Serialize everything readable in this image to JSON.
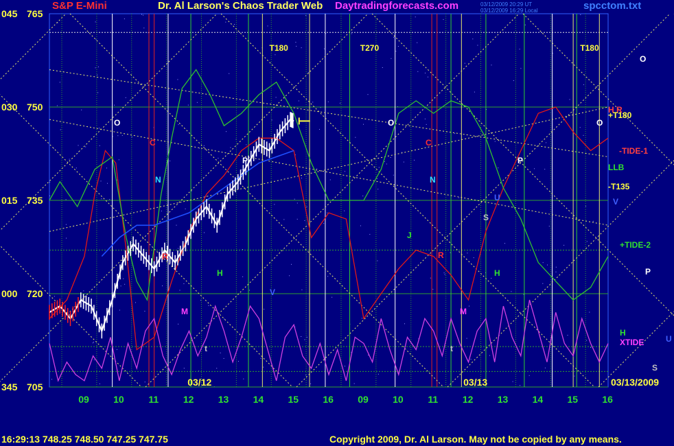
{
  "header": {
    "symbol_title": "S&P E-Mini",
    "app_title": "Dr. Al Larson's Chaos Trader Web",
    "site": "Daytradingforecasts.com",
    "timestamp_line1": "03/12/2009 20:29 UT",
    "timestamp_line2": "03/12/2009 16:29 Local",
    "file_name": "spcctom.txt"
  },
  "footer": {
    "quote": "16:29:13  748.25  748.50  747.25  747.75",
    "copyright": "Copyright 2009, Dr. Al Larson. May not be copied by any means."
  },
  "colors": {
    "background": "#00007f",
    "price_bars": "#ffffff",
    "red_line": "#e01818",
    "green_line": "#30c030",
    "blue_line": "#1f4fff",
    "magenta_xtide": "#d040e0",
    "gann_yellow": "#e8e870",
    "grid_green": "#2fa02f",
    "vertical_white": "#ffffff",
    "vertical_yellow": "#e8e870",
    "vertical_red": "#e02020",
    "vertical_green": "#30d030"
  },
  "chart_data": {
    "type": "line",
    "title": "S&P E-Mini",
    "ylabel_left": [
      "345",
      "000",
      "015",
      "030",
      "045"
    ],
    "y_ticks": [
      705,
      720,
      735,
      750,
      765
    ],
    "ylim": [
      705,
      765
    ],
    "x_session_labels": [
      "09",
      "10",
      "11",
      "12",
      "13",
      "14",
      "15",
      "16",
      "09",
      "10",
      "11",
      "12",
      "13",
      "14",
      "15",
      "16"
    ],
    "date_labels": [
      "03/12",
      "03/13",
      "03/13/2009"
    ],
    "grid": true,
    "timing_labels": [
      "T180",
      "T270",
      "T180"
    ],
    "right_labels": [
      "H R",
      "+T180",
      "O",
      "-TIDE-1",
      "LLB",
      "-T135",
      "V",
      "+TIDE-2",
      "P",
      "H",
      "XTIDE",
      "U",
      "S"
    ],
    "in_chart_letters_day1": [
      "O",
      "C",
      "N",
      "P",
      "H",
      "V",
      "M",
      "t",
      "R"
    ],
    "in_chart_letters_day2": [
      "O",
      "C",
      "N",
      "J",
      "R",
      "S",
      "U",
      "P",
      "H",
      "M",
      "t"
    ],
    "series": [
      {
        "name": "price",
        "x": [
          0,
          0.3,
          0.6,
          0.9,
          1.2,
          1.5,
          1.8,
          2.1,
          2.4,
          2.7,
          3.0,
          3.3,
          3.6,
          3.9,
          4.2,
          4.5,
          4.8,
          5.1,
          5.4,
          5.7,
          6.0,
          6.3,
          6.6,
          6.9,
          7.0
        ],
        "values": [
          717,
          718,
          716,
          719,
          718,
          714,
          719,
          725,
          728,
          726,
          724,
          727,
          725,
          728,
          732,
          734,
          731,
          736,
          738,
          741,
          744,
          743,
          746,
          748,
          747.75
        ]
      },
      {
        "name": "red",
        "x": [
          0,
          0.5,
          1.0,
          1.3,
          1.6,
          1.9,
          2.2,
          2.5,
          3.0,
          3.5,
          4.0,
          4.5,
          5.0,
          5.5,
          6.0,
          6.5,
          7.0,
          7.5,
          8.0,
          8.5,
          9.0,
          9.5,
          10.0,
          10.5,
          11.0,
          11.5,
          12.0,
          12.5,
          13.0,
          13.5,
          14.0,
          14.5,
          15.0,
          15.5,
          16.0
        ],
        "values": [
          716,
          719,
          726,
          736,
          743,
          741,
          727,
          711,
          713,
          722,
          730,
          736,
          739,
          743,
          745,
          745,
          743,
          729,
          733,
          732,
          716,
          720,
          724,
          727,
          726,
          723,
          719,
          730,
          737,
          743,
          749,
          750,
          746,
          743,
          745
        ]
      },
      {
        "name": "green",
        "x": [
          0,
          0.3,
          0.8,
          1.3,
          1.8,
          2.2,
          2.5,
          2.8,
          3.2,
          3.5,
          3.8,
          4.2,
          4.6,
          5.0,
          5.5,
          6.0,
          6.5,
          7.0,
          7.5,
          8.0,
          8.5,
          9.0,
          9.5,
          10.0,
          10.5,
          11.0,
          11.5,
          12.0,
          12.5,
          13.0,
          13.5,
          14.0,
          14.5,
          15.0,
          15.5,
          15.8,
          16.0
        ],
        "values": [
          735,
          738,
          734,
          740,
          742,
          729,
          722,
          719,
          736,
          745,
          753,
          756,
          752,
          747,
          749,
          752,
          754,
          749,
          741,
          735,
          735,
          735,
          740,
          749,
          751,
          749,
          751,
          750,
          745,
          737,
          732,
          725,
          722,
          719,
          721,
          724,
          726
        ]
      },
      {
        "name": "blue",
        "x": [
          1.5,
          2.0,
          2.5,
          3.0,
          3.5,
          4.0,
          4.5,
          5.0,
          5.5,
          6.0,
          6.5,
          7.0
        ],
        "values": [
          726,
          729,
          731,
          731,
          732,
          733,
          735,
          737,
          739,
          741,
          742,
          743
        ]
      },
      {
        "name": "xtide",
        "x": [
          0,
          0.25,
          0.5,
          0.75,
          1.0,
          1.25,
          1.5,
          1.75,
          2.0,
          2.25,
          2.5,
          2.75,
          3.0,
          3.25,
          3.5,
          3.75,
          4.0,
          4.25,
          4.5,
          4.75,
          5.0,
          5.25,
          5.5,
          5.75,
          6.0,
          6.25,
          6.5,
          6.75,
          7.0,
          7.25,
          7.5,
          7.75,
          8.0,
          8.25,
          8.5,
          8.75,
          9.0,
          9.25,
          9.5,
          9.75,
          10.0,
          10.25,
          10.5,
          10.75,
          11.0,
          11.25,
          11.5,
          11.75,
          12.0,
          12.25,
          12.5,
          12.75,
          13.0,
          13.25,
          13.5,
          13.75,
          14.0,
          14.25,
          14.5,
          14.75,
          15.0,
          15.25,
          15.5,
          15.75,
          16.0
        ],
        "values": [
          712,
          706,
          709,
          707,
          706,
          710,
          708,
          713,
          706,
          712,
          708,
          714,
          716,
          710,
          707,
          711,
          714,
          710,
          713,
          718,
          714,
          709,
          713,
          718,
          716,
          711,
          706,
          713,
          715,
          710,
          708,
          712,
          707,
          711,
          706,
          713,
          712,
          709,
          716,
          711,
          707,
          713,
          711,
          716,
          714,
          710,
          716,
          712,
          709,
          714,
          716,
          709,
          718,
          713,
          710,
          719,
          714,
          709,
          717,
          712,
          710,
          716,
          712,
          709,
          712
        ]
      }
    ],
    "gann_line_count": 20,
    "horizontal_levels": [
      705,
      707.5,
      711.5,
      720,
      727,
      735,
      750,
      762
    ]
  }
}
